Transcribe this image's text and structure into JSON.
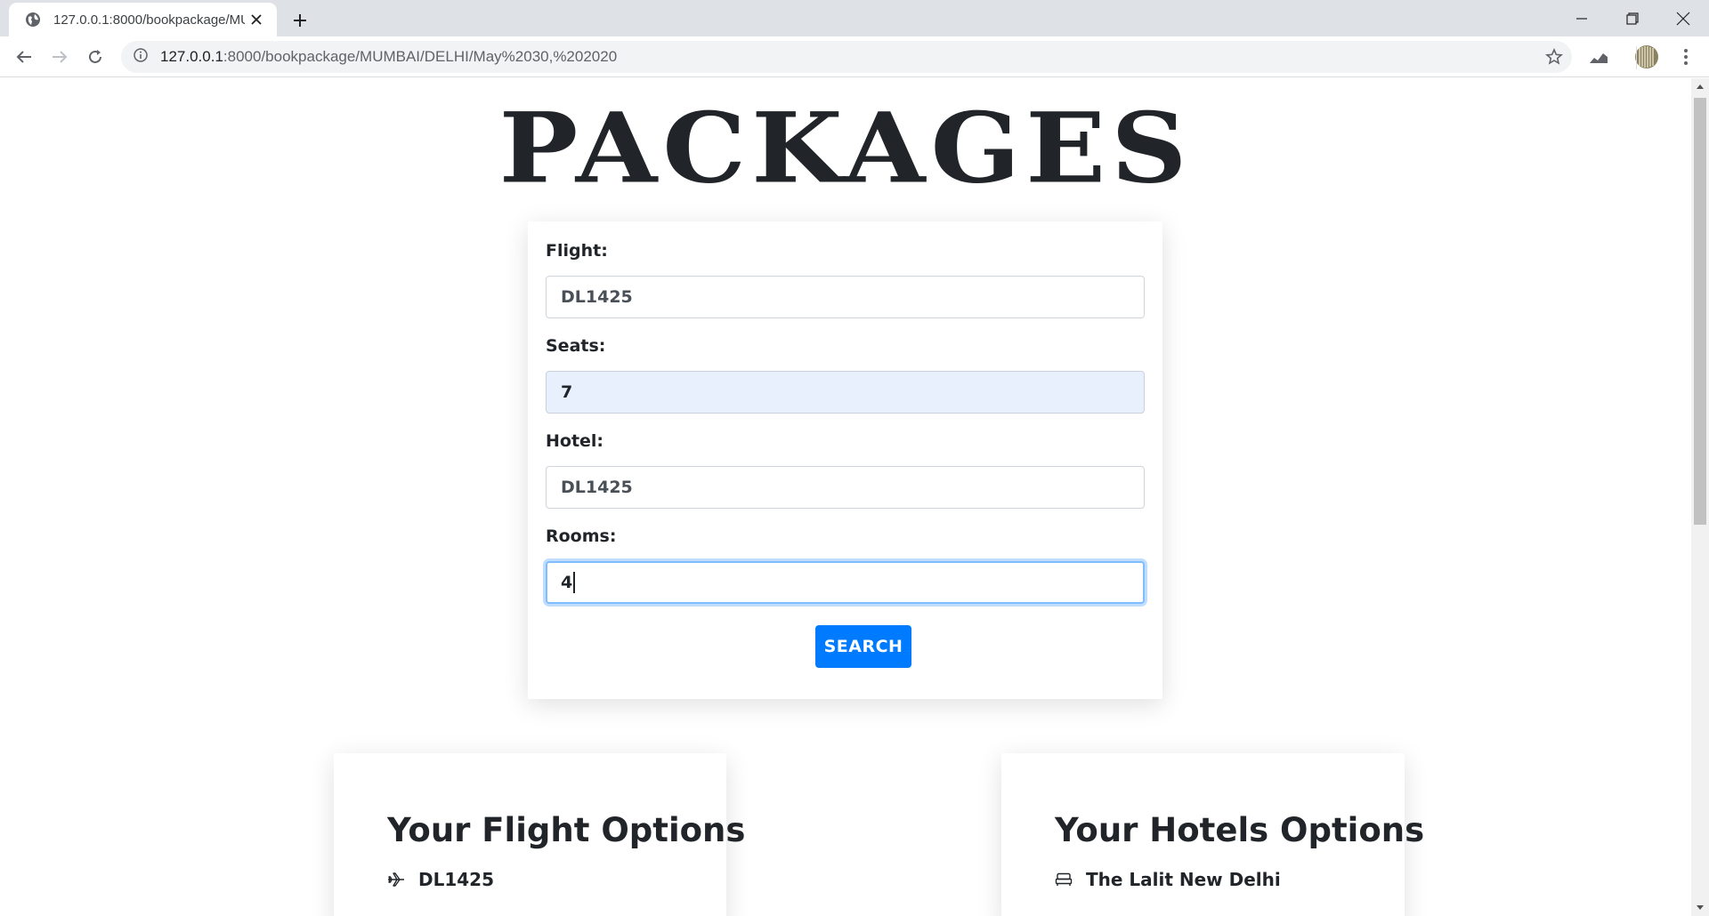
{
  "browser": {
    "tab_title": "127.0.0.1:8000/bookpackage/MUMBAI/DELHI/May%2030,%202020",
    "url_host": "127.0.0.1",
    "url_path": ":8000/bookpackage/MUMBAI/DELHI/May%2030,%202020"
  },
  "page": {
    "title": "PACKAGES"
  },
  "form": {
    "flight_label": "Flight:",
    "flight_value": "DL1425",
    "seats_label": "Seats:",
    "seats_value": "7",
    "hotel_label": "Hotel:",
    "hotel_value": "DL1425",
    "rooms_label": "Rooms:",
    "rooms_value": "4",
    "search_label": "SEARCH"
  },
  "flight_options": {
    "title": "Your Flight Options",
    "items": [
      {
        "label": "DL1425",
        "icon": "plane-icon"
      }
    ]
  },
  "hotel_options": {
    "title": "Your Hotels Options",
    "items": [
      {
        "label": "The Lalit New Delhi",
        "icon": "bed-icon"
      }
    ]
  },
  "colors": {
    "primary": "#007bff",
    "autofill": "#e8f0fe",
    "text": "#212529"
  }
}
